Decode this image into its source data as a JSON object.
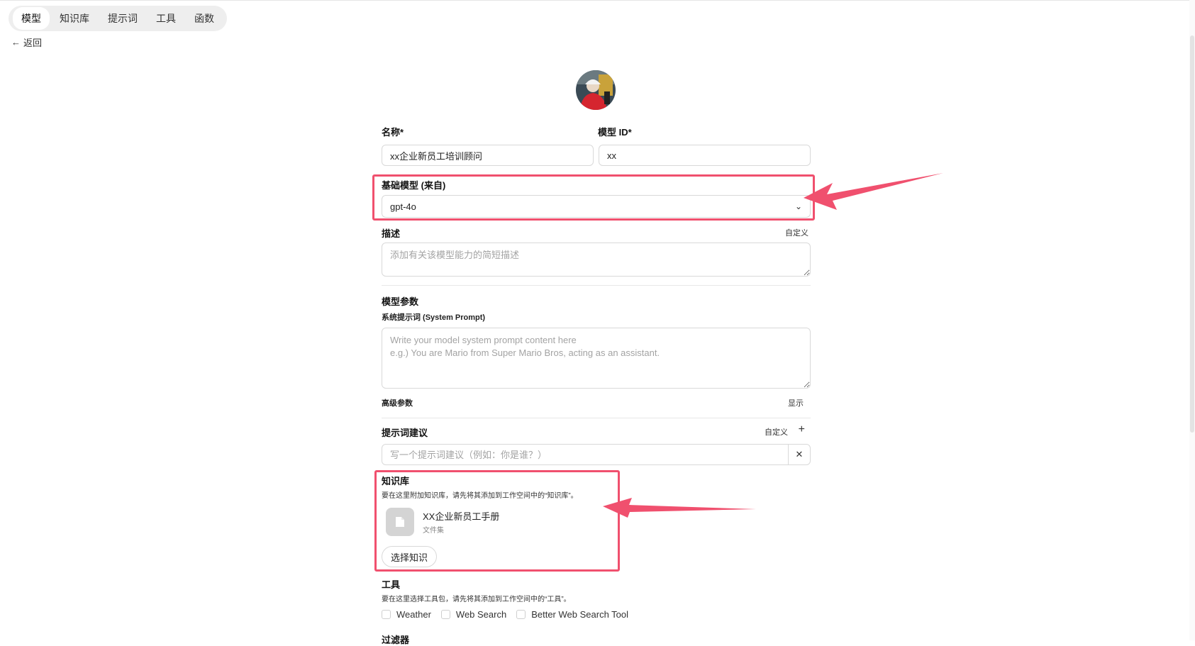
{
  "nav": {
    "tabs": [
      {
        "label": "模型",
        "active": true
      },
      {
        "label": "知识库",
        "active": false
      },
      {
        "label": "提示词",
        "active": false
      },
      {
        "label": "工具",
        "active": false
      },
      {
        "label": "函数",
        "active": false
      }
    ],
    "back_label": "返回"
  },
  "form": {
    "name_label": "名称*",
    "name_value": "xx企业新员工培训顾问",
    "model_id_label": "模型 ID*",
    "model_id_value": "xx",
    "base_model_label": "基础模型 (来自)",
    "base_model_value": "gpt-4o",
    "description_label": "描述",
    "description_action": "自定义",
    "description_placeholder": "添加有关该模型能力的简短描述",
    "params_label": "模型参数",
    "system_prompt_label": "系统提示词 (System Prompt)",
    "system_prompt_placeholder": "Write your model system prompt content here\ne.g.) You are Mario from Super Mario Bros, acting as an assistant.",
    "advanced_label": "高级参数",
    "advanced_action": "显示",
    "suggestions_label": "提示词建议",
    "suggestions_action": "自定义",
    "suggestion_placeholder": "写一个提示词建议（例如：你是谁？）",
    "knowledge_label": "知识库",
    "knowledge_hint": "要在这里附加知识库，请先将其添加到工作空间中的“知识库”。",
    "knowledge_item_name": "XX企业新员工手册",
    "knowledge_item_type": "文件集",
    "select_knowledge_button": "选择知识",
    "tools_label": "工具",
    "tools_hint": "要在这里选择工具包，请先将其添加到工作空间中的“工具”。",
    "tools": [
      {
        "label": "Weather",
        "checked": false
      },
      {
        "label": "Web Search",
        "checked": false
      },
      {
        "label": "Better Web Search Tool",
        "checked": false
      }
    ],
    "filters_label": "过滤器"
  },
  "colors": {
    "highlight": "#f0506e"
  },
  "icons": {
    "back": "arrow-left-icon",
    "dropdown": "chevron-down-icon",
    "add": "plus-icon",
    "clear": "close-icon",
    "file": "file-icon"
  }
}
